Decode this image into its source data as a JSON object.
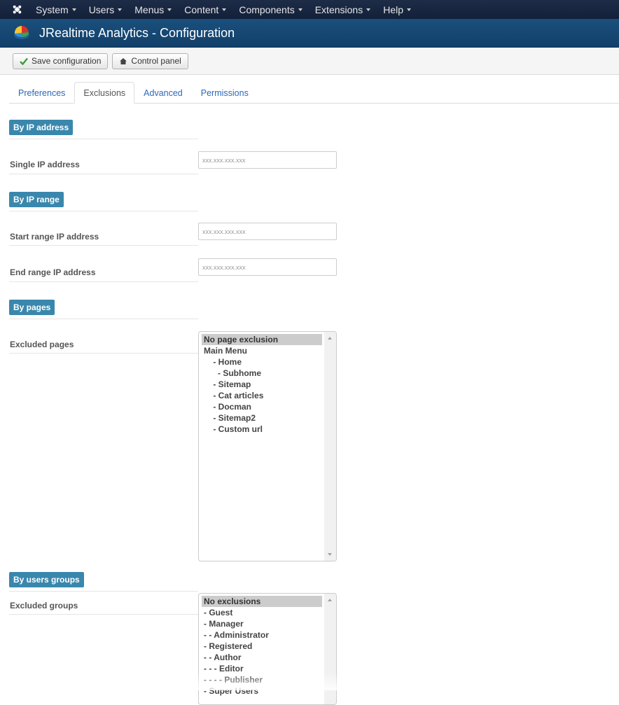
{
  "navbar": {
    "items": [
      {
        "label": "System"
      },
      {
        "label": "Users"
      },
      {
        "label": "Menus"
      },
      {
        "label": "Content"
      },
      {
        "label": "Components"
      },
      {
        "label": "Extensions"
      },
      {
        "label": "Help"
      }
    ]
  },
  "header": {
    "title": "JRealtime Analytics - Configuration"
  },
  "toolbar": {
    "save_label": "Save configuration",
    "control_panel_label": "Control panel"
  },
  "tabs": [
    {
      "label": "Preferences"
    },
    {
      "label": "Exclusions"
    },
    {
      "label": "Advanced"
    },
    {
      "label": "Permissions"
    }
  ],
  "active_tab": "Exclusions",
  "sections": {
    "ip_address": {
      "heading": "By IP address",
      "single_label": "Single IP address",
      "single_placeholder": "xxx.xxx.xxx.xxx"
    },
    "ip_range": {
      "heading": "By IP range",
      "start_label": "Start range IP address",
      "start_placeholder": "xxx.xxx.xxx.xxx",
      "end_label": "End range IP address",
      "end_placeholder": "xxx.xxx.xxx.xxx"
    },
    "pages": {
      "heading": "By pages",
      "label": "Excluded pages",
      "options": [
        "No page exclusion",
        "Main Menu",
        "    - Home",
        "      - Subhome",
        "    - Sitemap",
        "    - Cat articles",
        "    - Docman",
        "    - Sitemap2",
        "    - Custom url"
      ],
      "selected": "No page exclusion"
    },
    "groups": {
      "heading": "By users groups",
      "label": "Excluded groups",
      "options": [
        "No exclusions",
        "- Guest",
        "- Manager",
        "- - Administrator",
        "- Registered",
        "- - Author",
        "- - - Editor",
        "- - - - Publisher",
        "- Super Users"
      ],
      "selected": "No exclusions"
    }
  },
  "colors": {
    "navbar": "#17233a",
    "header": "#16466f",
    "section_label": "#3a87ad",
    "link": "#2a69b8"
  }
}
